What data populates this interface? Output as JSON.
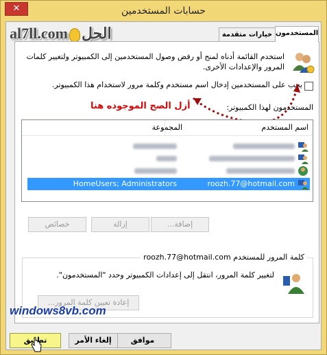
{
  "window": {
    "title": "حسابات المستخدمين",
    "close_glyph": "✕"
  },
  "tabs": [
    {
      "label": "المستخدمون"
    },
    {
      "label": "خيارات متقدمة"
    }
  ],
  "watermarks": {
    "top_logo": "al7ll.com",
    "top_logo_arabic": "الحل",
    "bottom_logo": "windows8vb.com"
  },
  "description": "استخدم القائمة أدناه لمنح أو رفض وصول المستخدمين إلى الكمبيوتر ولتغيير كلمات المرور والإعدادات الأخرى.",
  "require_password_checkbox": {
    "label": "يجب على المستخدمين إدخال اسم مستخدم وكلمة مرور لاستخدام هذا الكمبيوتر.",
    "checked": false
  },
  "annotation": {
    "text": "أزل الصح الموجوده هنا",
    "color": "#d10c0c"
  },
  "users_list": {
    "label": "المستخدمون لهذا الكمبيوتر:",
    "columns": {
      "name": "اسم المستخدم",
      "group": "المجموعة"
    },
    "rows": [
      {
        "name": "",
        "group": "",
        "blurred": true,
        "selected": false
      },
      {
        "name": "",
        "group": "",
        "blurred": true,
        "selected": false
      },
      {
        "name": "",
        "group": "",
        "blurred": true,
        "selected": false
      },
      {
        "name": "roozh.77@hotmail.com",
        "group": "HomeUsers; Administrators",
        "blurred": false,
        "selected": true
      }
    ]
  },
  "list_buttons": {
    "add": "إضافة...",
    "remove": "إزالة",
    "properties": "خصائص"
  },
  "password_group": {
    "title": "كلمة المرور للمستخدم roozh.77@hotmail.com",
    "text": "لتغيير كلمة المرور، انتقل إلى إعدادات الكمبيوتر وحدد \"المستخدمون\".",
    "reset_button": "إعادة تعيين كلمة المرور..."
  },
  "footer_buttons": {
    "ok": "موافق",
    "cancel": "إلغاء الأمر",
    "apply": "تطبيق"
  },
  "colors": {
    "titlebar": "#f2d777",
    "selection": "#3399ff",
    "close": "#c7372f"
  }
}
